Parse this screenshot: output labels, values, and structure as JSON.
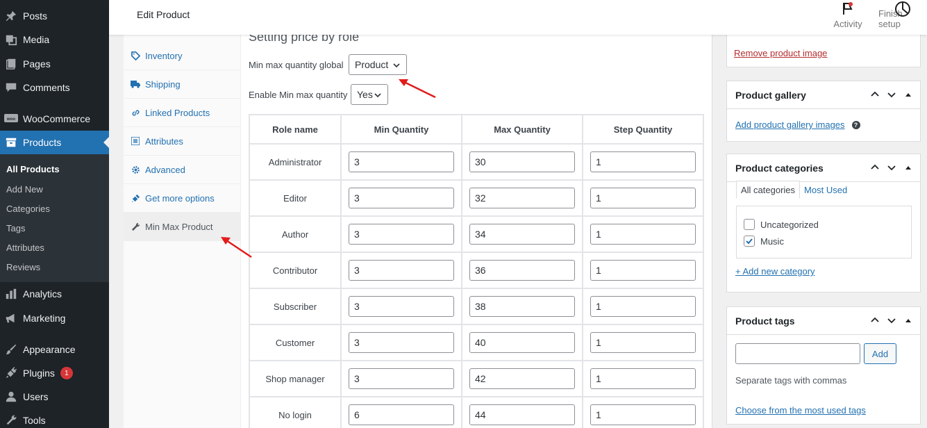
{
  "header": {
    "title": "Edit Product",
    "activity_label": "Activity",
    "finish_setup_label": "Finish setup"
  },
  "sidebar": {
    "items": [
      {
        "label": "Posts",
        "icon": "pin-icon"
      },
      {
        "label": "Media",
        "icon": "media-icon"
      },
      {
        "label": "Pages",
        "icon": "pages-icon"
      },
      {
        "label": "Comments",
        "icon": "comments-icon"
      },
      {
        "label": "WooCommerce",
        "icon": "woo-icon"
      },
      {
        "label": "Products",
        "icon": "archive-icon"
      },
      {
        "label": "Analytics",
        "icon": "bar-chart-icon"
      },
      {
        "label": "Marketing",
        "icon": "megaphone-icon"
      },
      {
        "label": "Appearance",
        "icon": "brush-icon"
      },
      {
        "label": "Plugins",
        "icon": "plugin-icon",
        "badge": "1"
      },
      {
        "label": "Users",
        "icon": "users-icon"
      },
      {
        "label": "Tools",
        "icon": "wrench-icon"
      }
    ],
    "submenu": [
      "All Products",
      "Add New",
      "Categories",
      "Tags",
      "Attributes",
      "Reviews"
    ]
  },
  "product_tabs": [
    {
      "label": "Inventory",
      "icon": "tag-icon"
    },
    {
      "label": "Shipping",
      "icon": "truck-icon"
    },
    {
      "label": "Linked Products",
      "icon": "link-icon"
    },
    {
      "label": "Attributes",
      "icon": "list-icon"
    },
    {
      "label": "Advanced",
      "icon": "gear-icon"
    },
    {
      "label": "Get more options",
      "icon": "plug-icon"
    },
    {
      "label": "Min Max Product",
      "icon": "wrench-icon"
    }
  ],
  "panel": {
    "title": "Setting price by role",
    "global_label": "Min max quantity global",
    "global_value": "Product",
    "enable_label": "Enable Min max quantity",
    "enable_value": "Yes",
    "headers": [
      "Role name",
      "Min Quantity",
      "Max Quantity",
      "Step Quantity"
    ],
    "rows": [
      {
        "role": "Administrator",
        "min": "3",
        "max": "30",
        "step": "1"
      },
      {
        "role": "Editor",
        "min": "3",
        "max": "32",
        "step": "1"
      },
      {
        "role": "Author",
        "min": "3",
        "max": "34",
        "step": "1"
      },
      {
        "role": "Contributor",
        "min": "3",
        "max": "36",
        "step": "1"
      },
      {
        "role": "Subscriber",
        "min": "3",
        "max": "38",
        "step": "1"
      },
      {
        "role": "Customer",
        "min": "3",
        "max": "40",
        "step": "1"
      },
      {
        "role": "Shop manager",
        "min": "3",
        "max": "42",
        "step": "1"
      },
      {
        "role": "No login",
        "min": "6",
        "max": "44",
        "step": "1"
      }
    ]
  },
  "right": {
    "remove_image": "Remove product image",
    "gallery_title": "Product gallery",
    "gallery_add": "Add product gallery images",
    "categories_title": "Product categories",
    "cat_tab_all": "All categories",
    "cat_tab_used": "Most Used",
    "categories": [
      {
        "label": "Uncategorized",
        "checked": false
      },
      {
        "label": "Music",
        "checked": true
      }
    ],
    "add_category": "+ Add new category",
    "tags_title": "Product tags",
    "tags_add": "Add",
    "tags_hint": "Separate tags with commas",
    "tags_choose": "Choose from the most used tags"
  },
  "colors": {
    "sidebar_bg": "#1d2327",
    "accent": "#2271b1",
    "badge": "#d63638",
    "annotation_arrow": "#e31b1b"
  }
}
